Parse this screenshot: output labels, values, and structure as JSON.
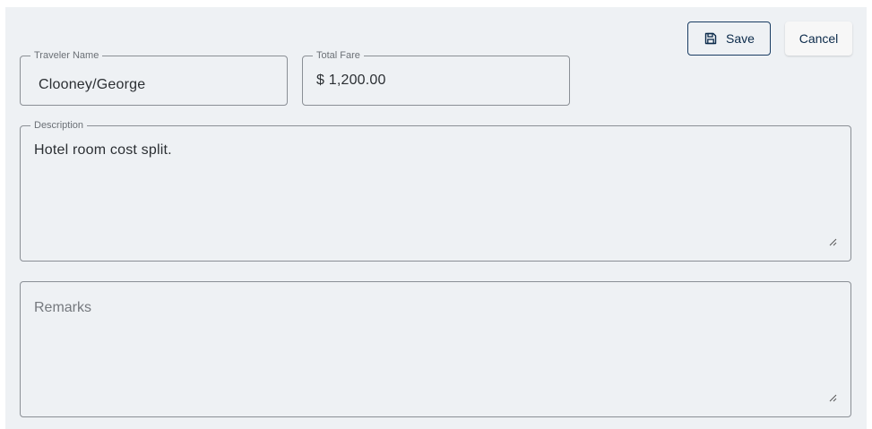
{
  "toolbar": {
    "save_label": "Save",
    "cancel_label": "Cancel"
  },
  "form": {
    "traveler_name": {
      "label": "Traveler Name",
      "value": "Clooney/George"
    },
    "total_fare": {
      "label": "Total Fare",
      "value": "$ 1,200.00"
    },
    "description": {
      "label": "Description",
      "value": "Hotel room cost split."
    },
    "remarks": {
      "placeholder": "Remarks"
    }
  },
  "colors": {
    "panel_background": "#eef1f4",
    "primary_text": "#0b2a4a",
    "border": "#8a8f95"
  },
  "icons": {
    "save": "floppy-disk-icon",
    "resize": "resize-handle-icon"
  }
}
